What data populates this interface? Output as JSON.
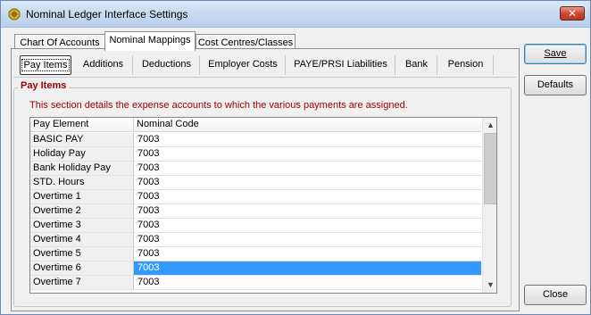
{
  "window": {
    "title": "Nominal Ledger Interface Settings",
    "close_glyph": "✕"
  },
  "tabs": [
    {
      "label": "Chart Of Accounts"
    },
    {
      "label": "Nominal Mappings"
    },
    {
      "label": "Cost Centres/Classes"
    }
  ],
  "subtabs": [
    {
      "label": "Pay Items"
    },
    {
      "label": "Additions"
    },
    {
      "label": "Deductions"
    },
    {
      "label": "Employer Costs"
    },
    {
      "label": "PAYE/PRSI Liabilities"
    },
    {
      "label": "Bank"
    },
    {
      "label": "Pension"
    }
  ],
  "group": {
    "title": "Pay Items",
    "description": "This section details the expense accounts to which the various payments are assigned."
  },
  "grid": {
    "columns": [
      "Pay Element",
      "Nominal Code"
    ],
    "rows": [
      [
        "BASIC PAY",
        "7003"
      ],
      [
        "Holiday Pay",
        "7003"
      ],
      [
        "Bank Holiday Pay",
        "7003"
      ],
      [
        "STD. Hours",
        "7003"
      ],
      [
        "Overtime 1",
        "7003"
      ],
      [
        "Overtime 2",
        "7003"
      ],
      [
        "Overtime 3",
        "7003"
      ],
      [
        "Overtime 4",
        "7003"
      ],
      [
        "Overtime 5",
        "7003"
      ],
      [
        "Overtime 6",
        "7003"
      ],
      [
        "Overtime 7",
        "7003"
      ]
    ],
    "selected_row": "Overtime 6"
  },
  "buttons": {
    "save": "Save",
    "defaults": "Defaults",
    "close": "Close"
  },
  "colors": {
    "accent_red": "#a00000",
    "selection": "#3399ff"
  }
}
